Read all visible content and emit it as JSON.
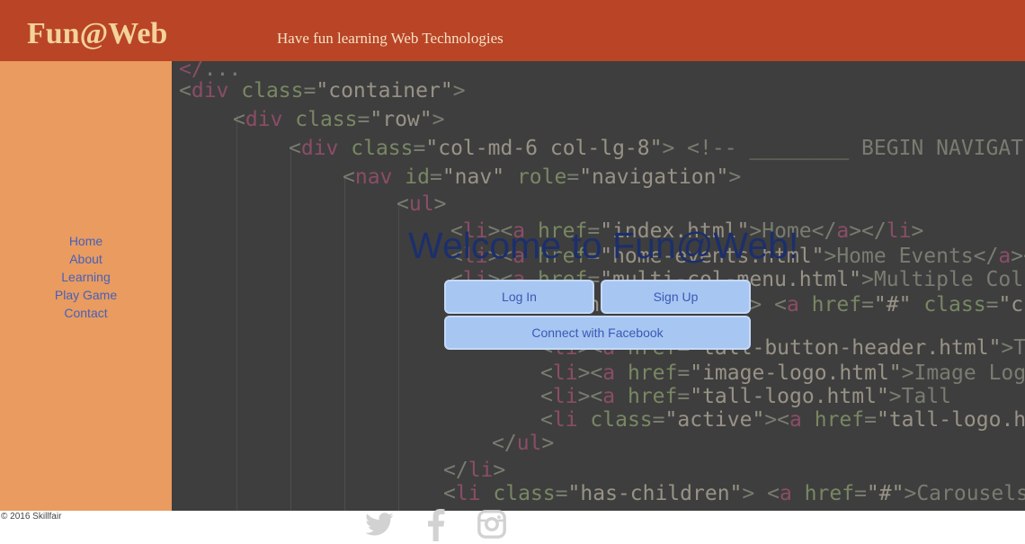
{
  "header": {
    "logo": "Fun@Web",
    "tagline": "Have fun learning Web Technologies"
  },
  "nav": {
    "items": [
      "Home",
      "About",
      "Learning",
      "Play Game",
      "Contact"
    ]
  },
  "hero": {
    "title": "Welcome to Fun@Web!",
    "login_label": "Log In",
    "signup_label": "Sign Up",
    "facebook_label": "Connect with Facebook"
  },
  "footer": {
    "copyright": "© 2016 Skillfair",
    "social": [
      "twitter-icon",
      "facebook-icon",
      "instagram-icon"
    ]
  },
  "colors": {
    "header_bg": "#b94426",
    "sidebar_bg": "#e99b60",
    "button_bg": "#a7c6f2",
    "title_color": "#1c2f6c",
    "link_color": "#4661b8"
  }
}
